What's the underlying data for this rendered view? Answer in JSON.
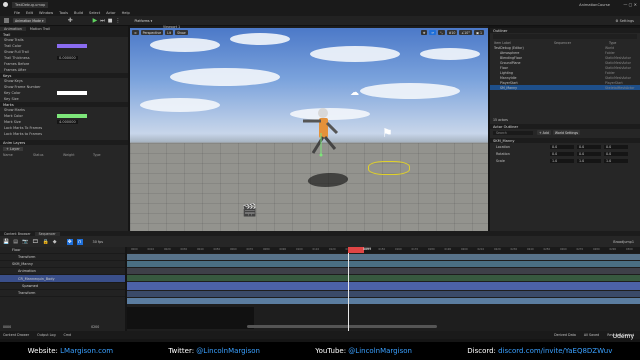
{
  "app": {
    "title": "TestDebug.umap",
    "project": "AnimationCourse"
  },
  "menu": [
    "File",
    "Edit",
    "Window",
    "Tools",
    "Build",
    "Select",
    "Actor",
    "Help"
  ],
  "toolbar": {
    "mode": "Animation Mode",
    "platforms": "Platforms"
  },
  "left_panel": {
    "tabs": [
      "Animation",
      "Motion Trail"
    ],
    "sections": [
      {
        "title": "Trail",
        "props": [
          "Show Trails",
          "Trail Color",
          "Show Full Trail",
          "Trail Thickness",
          "Frames Before",
          "Frames After"
        ]
      },
      {
        "title": "Keys",
        "props": [
          "Show Keys",
          "Show Frame Number",
          "Key Color",
          "Key Size"
        ]
      },
      {
        "title": "Marks",
        "props": [
          "Show Marks",
          "Mark Color",
          "Mark Size",
          "Lock Marks To Frames",
          "Lock Marks to Frames"
        ]
      }
    ],
    "values": {
      "trail_thickness": "0.000000",
      "mark_size": "4.000000"
    },
    "colors": {
      "trail": "#8a6cf0",
      "key": "#ffffff",
      "mark": "#7de67a"
    },
    "layers": {
      "title": "Anim Layers",
      "add": "+ Layer",
      "cols": [
        "Name",
        "Status",
        "Weight",
        "Type"
      ]
    }
  },
  "viewport": {
    "tab": "Viewport 1",
    "buttons": [
      "Perspective",
      "Lit",
      "Show"
    ]
  },
  "outliner": {
    "tab": "Outliner",
    "cols": [
      "Item Label",
      "Sequencer",
      "Type"
    ],
    "items": [
      {
        "label": "TestDebug (Editor)",
        "type": "World"
      },
      {
        "label": "Atmosphere",
        "type": "Folder"
      },
      {
        "label": "BlendingFloor",
        "type": "StaticMeshActor"
      },
      {
        "label": "GroundPlane",
        "type": "StaticMeshActor"
      },
      {
        "label": "Floor",
        "type": "StaticMeshActor"
      },
      {
        "label": "Lighting",
        "type": "Folder"
      },
      {
        "label": "MannyIdle",
        "type": "StaticMeshActor"
      },
      {
        "label": "PlayerStart",
        "type": "PlayerStart"
      },
      {
        "label": "SM_Manny",
        "type": "SkeletalMeshActor"
      }
    ],
    "count": "15 actors"
  },
  "details": {
    "tab": "Actor Outliner",
    "search": "Search",
    "title": "SKM_Manny",
    "rows": [
      {
        "label": "Location",
        "x": "0.0",
        "y": "0.0",
        "z": "0.0"
      },
      {
        "label": "Rotation",
        "x": "0.0",
        "y": "0.0",
        "z": "0.0"
      },
      {
        "label": "Scale",
        "x": "1.0",
        "y": "1.0",
        "z": "1.0"
      }
    ]
  },
  "sequencer": {
    "tabs": [
      "Content Browser",
      "Sequencer"
    ],
    "fps": "30 fps",
    "bread": "BroadJump1",
    "tracks": [
      "Floor",
      "Transform",
      "SKM_Manny",
      "Animation",
      "CR_Mannequin_Body",
      "Spawned",
      "Transform"
    ],
    "ticks": [
      "0000",
      "0010",
      "0020",
      "0030",
      "0040",
      "0050",
      "0060",
      "0070",
      "0080",
      "0090",
      "0100",
      "0110",
      "0120",
      "0130",
      "0140",
      "0150",
      "0160",
      "0170",
      "0180",
      "0190",
      "0200",
      "0210",
      "0220",
      "0230",
      "0240",
      "0250",
      "0260",
      "0270",
      "0280",
      "0290",
      "0300"
    ],
    "playhead": "0099",
    "range_start": "0000",
    "range_end": "0200"
  },
  "status": [
    "Content Drawer",
    "Output Log",
    "Cmd",
    "Derived Data",
    "All Saved",
    "Revision Control"
  ],
  "footer": {
    "website_label": "Website:",
    "website": "LMargison.com",
    "twitter_label": "Twitter:",
    "twitter": "@LincolnMargison",
    "youtube_label": "YouTube:",
    "youtube": "@LincolnMargison",
    "discord_label": "Discord:",
    "discord": "discord.com/invite/YaEQ8DZWuv"
  },
  "watermark": "Udemy"
}
